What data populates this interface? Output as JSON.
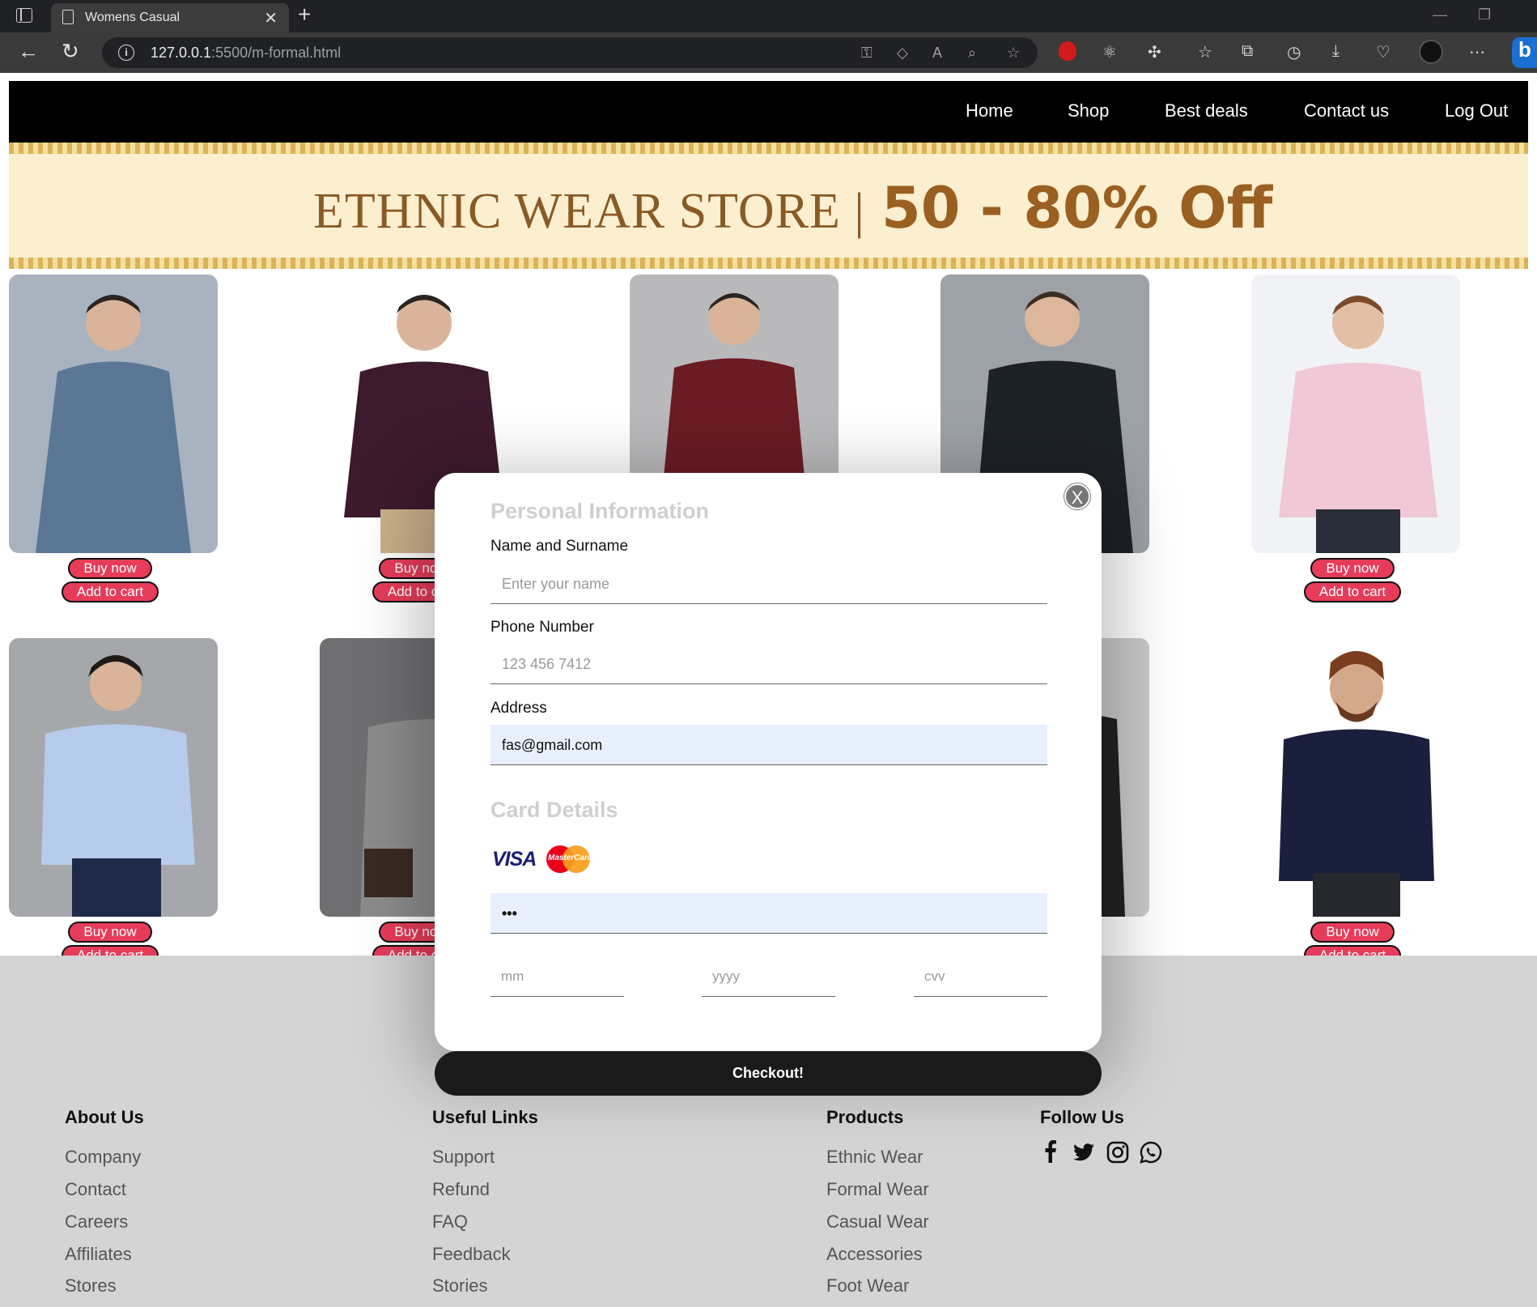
{
  "browser": {
    "tab_title": "Womens Casual",
    "url_host": "127.0.0.1",
    "url_rest": ":5500/m-formal.html"
  },
  "nav": {
    "items": [
      "Home",
      "Shop",
      "Best deals",
      "Contact us",
      "Log Out"
    ]
  },
  "banner": {
    "left_text": "ETHNIC WEAR STORE |",
    "right_text": "50 - 80% Off"
  },
  "products": {
    "buy_label": "Buy now",
    "cart_label": "Add to cart",
    "shirt_colors": [
      "#5a7896",
      "#3d1a2e",
      "#6b1b24",
      "#1d2227",
      "#f0c8d6",
      "#b7ccec",
      "#8c8c8c",
      "#222222",
      "#1b1f3e",
      "#1b1f3e"
    ]
  },
  "modal": {
    "close_label": "X",
    "personal_title": "Personal Information",
    "name_label": "Name and Surname",
    "name_placeholder": "Enter your name",
    "phone_label": "Phone Number",
    "phone_placeholder": "123 456 7412",
    "address_label": "Address",
    "address_value": "fas@gmail.com",
    "card_title": "Card Details",
    "visa_text": "VISA",
    "mastercard_text": "MasterCard",
    "card_number_value": "•••",
    "mm_placeholder": "mm",
    "yyyy_placeholder": "yyyy",
    "cvv_placeholder": "cvv",
    "checkout_label": "Checkout!"
  },
  "footer": {
    "about": {
      "title": "About Us",
      "links": [
        "Company",
        "Contact",
        "Careers",
        "Affiliates",
        "Stores"
      ]
    },
    "useful": {
      "title": "Useful Links",
      "links": [
        "Support",
        "Refund",
        "FAQ",
        "Feedback",
        "Stories"
      ]
    },
    "products": {
      "title": "Products",
      "links": [
        "Ethnic Wear",
        "Formal Wear",
        "Casual Wear",
        "Accessories",
        "Foot Wear"
      ]
    },
    "follow": {
      "title": "Follow Us",
      "icons": [
        "facebook-icon",
        "twitter-icon",
        "instagram-icon",
        "whatsapp-icon"
      ]
    }
  },
  "colors": {
    "accent_button": "#e63c5a",
    "nav_bg": "#000000",
    "footer_bg": "#d4d4d4",
    "autofill_bg": "#e8f0fe"
  }
}
